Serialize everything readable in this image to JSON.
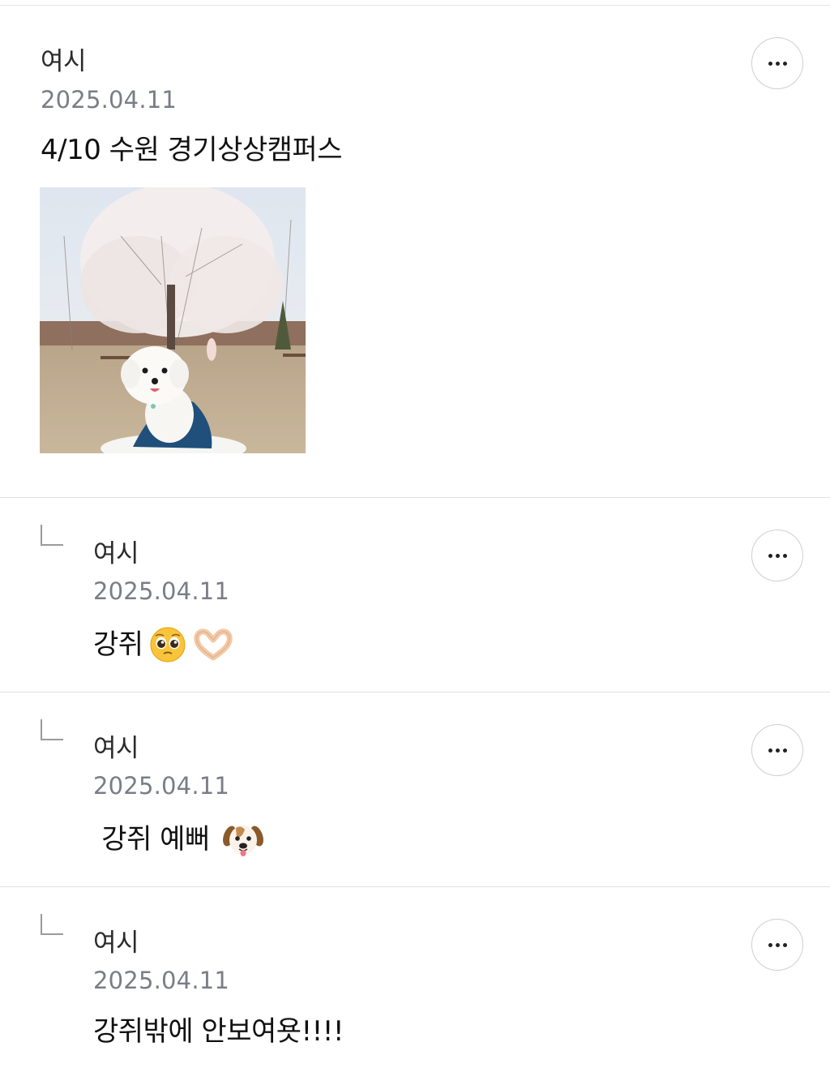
{
  "post": {
    "author": "여시",
    "date": "2025.04.11",
    "content": "4/10 수원 경기상상캠퍼스",
    "more_icon": "more-horizontal-icon",
    "image_icon": "dog-photo"
  },
  "replies": [
    {
      "author": "여시",
      "date": "2025.04.11",
      "content": "강쥐",
      "emojis": [
        "pleading-face-emoji",
        "heart-hands-emoji"
      ]
    },
    {
      "author": "여시",
      "date": "2025.04.11",
      "content": " 강쥐 예뻐 ",
      "emojis": [
        "dog-face-emoji"
      ]
    },
    {
      "author": "여시",
      "date": "2025.04.11",
      "content": "강쥐밖에 안보여욧!!!!",
      "emojis": []
    }
  ],
  "colors": {
    "date_gray": "#7a7d86",
    "divider": "#e0e0e0"
  }
}
